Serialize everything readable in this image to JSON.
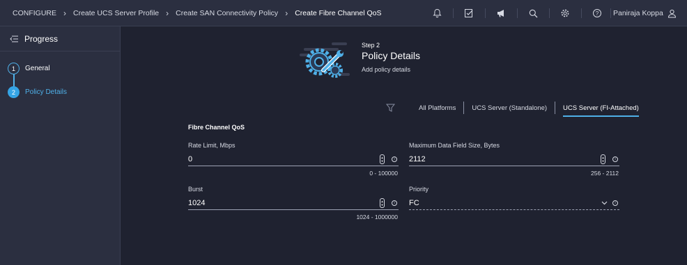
{
  "breadcrumb": [
    "CONFIGURE",
    "Create UCS Server Profile",
    "Create SAN Connectivity Policy",
    "Create Fibre Channel QoS"
  ],
  "header_icons": [
    "bell-icon",
    "checklist-icon",
    "megaphone-icon",
    "search-icon",
    "gear-icon",
    "help-icon"
  ],
  "user": {
    "name": "Paniraja Koppa",
    "icon": "user-icon"
  },
  "sidebar": {
    "title": "Progress",
    "steps": [
      {
        "number": "1",
        "label": "General",
        "state": "completed"
      },
      {
        "number": "2",
        "label": "Policy Details",
        "state": "active"
      }
    ]
  },
  "header": {
    "step": "Step 2",
    "title": "Policy Details",
    "subtitle": "Add policy details"
  },
  "platforms": {
    "tabs": [
      "All Platforms",
      "UCS Server (Standalone)",
      "UCS Server (FI-Attached)"
    ],
    "active": "UCS Server (FI-Attached)"
  },
  "form": {
    "section_title": "Fibre Channel QoS",
    "rate_limit": {
      "label": "Rate Limit, Mbps",
      "value": "0",
      "hint": "0 - 100000"
    },
    "max_data_field": {
      "label": "Maximum Data Field Size, Bytes",
      "value": "2112",
      "hint": "256 - 2112"
    },
    "burst": {
      "label": "Burst",
      "value": "1024",
      "hint": "1024 - 1000000"
    },
    "priority": {
      "label": "Priority",
      "value": "FC"
    }
  },
  "colors": {
    "accent": "#4fb0e8",
    "background": "#1f2230",
    "panel": "#2b2f40"
  }
}
